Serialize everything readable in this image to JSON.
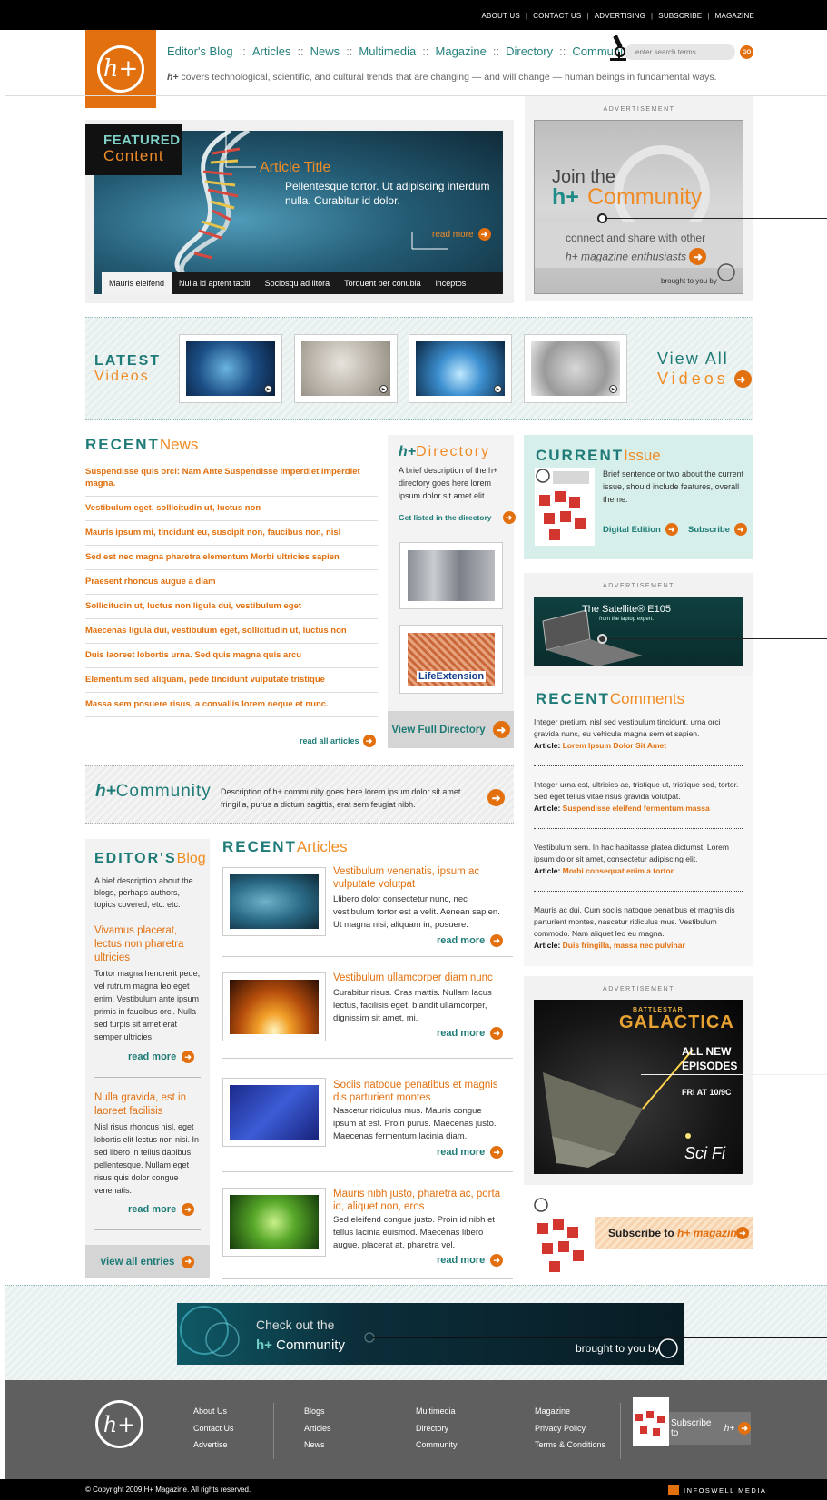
{
  "top_links": [
    "ABOUT US",
    "CONTACT US",
    "ADVERTISING",
    "SUBSCRIBE",
    "MAGAZINE"
  ],
  "logo_text": "h+",
  "nav": [
    "Editor's Blog",
    "Articles",
    "News",
    "Multimedia",
    "Magazine",
    "Directory",
    "Community"
  ],
  "nav_sep": "::",
  "search": {
    "placeholder": "enter search terms ...",
    "go": "GO"
  },
  "tagline": {
    "brand": "h+",
    "text": " covers technological, scientific, and cultural trends that are changing — and will change — human beings in fundamental ways."
  },
  "featured": {
    "label_1": "FEATURED",
    "label_2": "Content",
    "title": "Article Title",
    "description": "Pellentesque tortor. Ut adipiscing interdum nulla. Curabitur id dolor.",
    "more": "read more",
    "tabs": [
      "Mauris eleifend",
      "Nulla id aptent taciti",
      "Sociosqu ad litora",
      "Torquent per conubia",
      "inceptos"
    ]
  },
  "ad_label": "ADVERTISEMENT",
  "ad1": {
    "join": "Join the",
    "brand": "h+",
    "community": "Community",
    "line1": "connect and share with other",
    "line2": "h+ magazine enthusiasts",
    "by": "brought to you by"
  },
  "videos": {
    "h1": "LATEST",
    "h2": "Videos",
    "all1": "View All",
    "all2": "Videos"
  },
  "news": {
    "head_a": "RECENT",
    "head_b": "News",
    "items": [
      "Suspendisse quis orci: Nam Ante Suspendisse imperdiet imperdiet magna.",
      "Vestibulum eget, sollicitudin ut, luctus non",
      "Mauris ipsum mi, tincidunt eu, suscipit non, faucibus non, nisl",
      "Sed est nec magna pharetra elementum Morbi ultricies sapien",
      "Praesent rhoncus augue a diam",
      "Sollicitudin ut, luctus non ligula dui, vestibulum eget",
      "Maecenas ligula dui, vestibulum eget, sollicitudin ut, luctus non",
      "Duis laoreet lobortis urna. Sed quis magna quis arcu",
      "Elementum sed aliquam, pede tincidunt vulputate tristique",
      "Massa sem posuere risus, a convallis lorem neque et nunc."
    ],
    "more": "read all articles"
  },
  "directory": {
    "head_a": "h+",
    "head_b": "Directory",
    "desc": "A brief description of the h+ directory goes here lorem ipsum dolor sit amet elit.",
    "get": "Get listed in the directory",
    "logo2": "LifeExtension",
    "view": "View Full Directory"
  },
  "issue": {
    "head_a": "CURRENT",
    "head_b": "Issue",
    "desc": "Brief sentence or two about the current issue, should include features, overall theme.",
    "digital": "Digital Edition",
    "subscribe": "Subscribe"
  },
  "ad2": {
    "title": "The Satellite® E105",
    "sub": "from the laptop expert."
  },
  "comments": {
    "head_a": "RECENT",
    "head_b": "Comments",
    "article_label": "Article: ",
    "items": [
      {
        "text": "Integer pretium, nisl sed vestibulum tincidunt, urna orci gravida nunc, eu vehicula magna sem et sapien.",
        "article": "Lorem Ipsum Dolor Sit Amet"
      },
      {
        "text": "Integer urna est, ultricies ac, tristique ut, tristique sed, tortor. Sed eget tellus vitae risus gravida volutpat.",
        "article": "Suspendisse eleifend fermentum massa"
      },
      {
        "text": "Vestibulum sem. In hac habitasse platea dictumst. Lorem ipsum dolor sit amet, consectetur adipiscing elit.",
        "article": "Morbi consequat enim a tortor"
      },
      {
        "text": "Mauris ac dui. Cum sociis natoque penatibus et magnis dis parturient montes, nascetur ridiculus mus. Vestibulum commodo. Nam aliquet leo eu magna.",
        "article": "Duis fringilla, massa nec pulvinar"
      }
    ]
  },
  "ad3": {
    "bs": "BATTLESTAR",
    "title": "GALACTICA",
    "new1": "ALL NEW",
    "new2": "EPISODES",
    "time": "FRI AT 10/9C",
    "channel": "Sci Fi"
  },
  "subscribe_box": {
    "text": "Subscribe to ",
    "brand": "h+ magazine"
  },
  "community": {
    "head_a": "h+",
    "head_b": "Community",
    "desc": "Description of h+ community goes here lorem ipsum dolor sit amet. fringilla, purus a dictum sagittis, erat sem feugiat nibh."
  },
  "blog": {
    "head_a": "EDITOR'S",
    "head_b": "Blog",
    "desc": "A bief description about the blogs, perhaps authors, topics covered, etc. etc.",
    "entries": [
      {
        "title": "Vivamus placerat, lectus non pharetra ultricies",
        "text": "Tortor magna hendrerit pede, vel rutrum magna leo eget enim. Vestibulum ante ipsum primis in faucibus orci. Nulla sed turpis sit amet erat semper ultricies",
        "more": "read more"
      },
      {
        "title": "Nulla gravida, est in laoreet facilisis",
        "text": "Nisl risus rhoncus nisl, eget lobortis elit lectus non nisi. In sed libero in tellus dapibus pellentesque. Nullam eget risus quis dolor congue venenatis.",
        "more": "read more"
      }
    ],
    "all": "view all entries"
  },
  "articles": {
    "head_a": "RECENT",
    "head_b": "Articles",
    "items": [
      {
        "title": "Vestibulum venenatis, ipsum ac vulputate volutpat",
        "text": "Llibero dolor consectetur nunc, nec vestibulum tortor est a velit. Aenean sapien. Ut magna nisi, aliquam in, posuere.",
        "more": "read more"
      },
      {
        "title": "Vestibulum ullamcorper diam nunc",
        "text": "Curabitur risus. Cras mattis. Nullam lacus lectus, facilisis eget, blandit ullamcorper, dignissim sit amet, mi.",
        "more": "read more"
      },
      {
        "title": "Sociis natoque penatibus et magnis dis parturient montes",
        "text": "Nascetur ridiculus mus. Mauris congue ipsum at est. Proin purus. Maecenas justo. Maecenas fermentum lacinia diam.",
        "more": "read more"
      },
      {
        "title": "Mauris nibh justo, pharetra ac, porta id, aliquet non, eros",
        "text": "Sed eleifend congue justo. Proin id nibh et tellus lacinia euismod. Maecenas libero augue, placerat at, pharetra vel.",
        "more": "read more"
      }
    ]
  },
  "banner": {
    "line1": "Check out the",
    "brand": "h+",
    "line2": " Community",
    "by": "brought to you by"
  },
  "footer": {
    "col1": [
      "About Us",
      "Contact Us",
      "Advertise"
    ],
    "col2": [
      "Blogs",
      "Articles",
      "News"
    ],
    "col3": [
      "Multimedia",
      "Directory",
      "Community"
    ],
    "col4": [
      "Magazine",
      "Privacy Policy",
      "Terms & Conditions"
    ],
    "subscribe": "Subscribe to ",
    "brand": "h+",
    "copyright": "© Copyright 2009 H+ Magazine. All rights reserved.",
    "company": "INFOSWELL MEDIA"
  },
  "colors": {
    "accent": "#e2700f",
    "teal": "#1f7b77",
    "footer": "#5f5f5f"
  }
}
